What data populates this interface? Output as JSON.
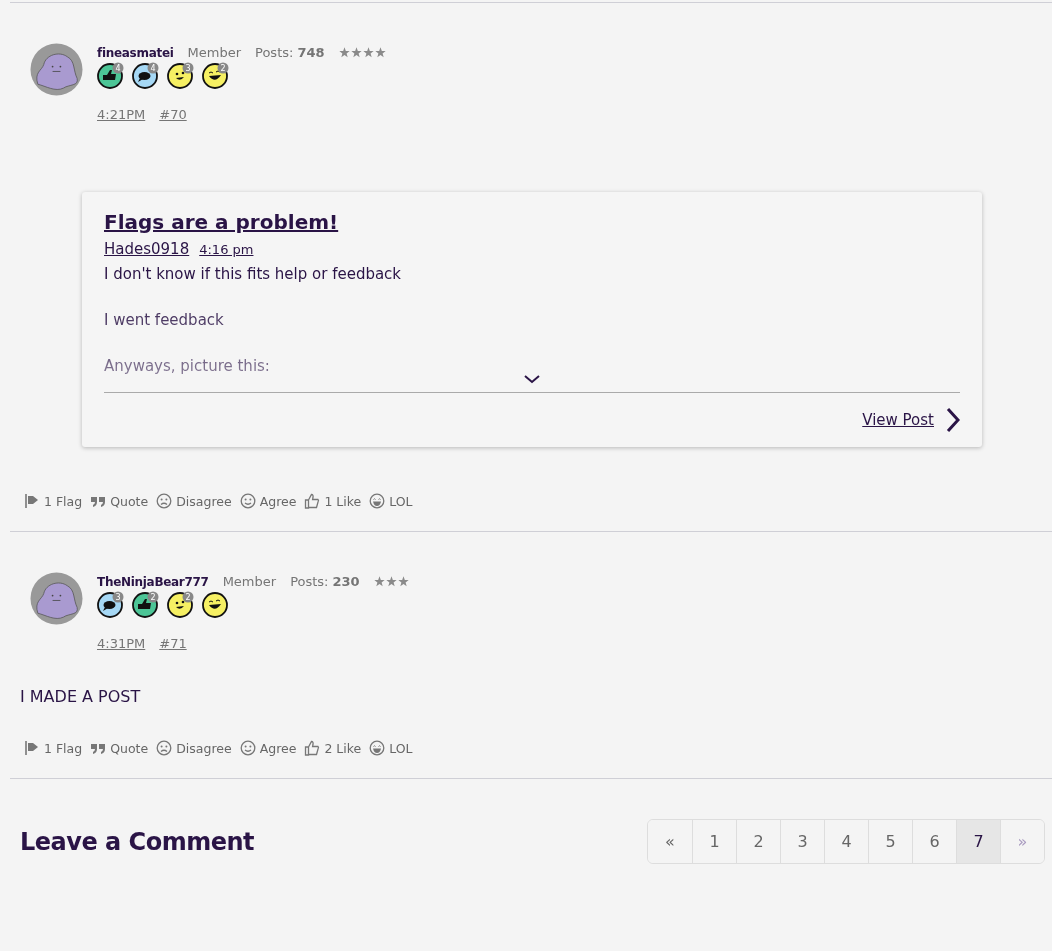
{
  "posts": [
    {
      "author": "fineasmatei",
      "role": "Member",
      "posts_label": "Posts:",
      "posts_count": "748",
      "stars": 4,
      "badges": [
        {
          "kind": "like",
          "count": "4"
        },
        {
          "kind": "comment",
          "count": "4"
        },
        {
          "kind": "wink",
          "count": "3"
        },
        {
          "kind": "grin",
          "count": "2"
        }
      ],
      "time": "4:21PM",
      "number": "#70",
      "quote": {
        "title": "Flags are a problem!",
        "author": "Hades0918",
        "time": "4:16 pm",
        "collapsed": true,
        "paragraphs": [
          "I don't know if this fits help or feedback",
          "I went feedback",
          "Anyways, picture this:"
        ],
        "link": "View Post"
      },
      "actions": [
        {
          "kind": "flag",
          "label": "1 Flag"
        },
        {
          "kind": "quote",
          "label": "Quote"
        },
        {
          "kind": "disagree",
          "label": "Disagree"
        },
        {
          "kind": "agree",
          "label": "Agree"
        },
        {
          "kind": "like",
          "label": "1 Like"
        },
        {
          "kind": "lol",
          "label": "LOL"
        }
      ]
    },
    {
      "author": "TheNinjaBear777",
      "role": "Member",
      "posts_label": "Posts:",
      "posts_count": "230",
      "stars": 3,
      "badges": [
        {
          "kind": "comment",
          "count": "3"
        },
        {
          "kind": "like",
          "count": "2"
        },
        {
          "kind": "wink",
          "count": "2"
        },
        {
          "kind": "grin"
        }
      ],
      "time": "4:31PM",
      "number": "#71",
      "body": "I MADE A POST",
      "actions": [
        {
          "kind": "flag",
          "label": "1 Flag"
        },
        {
          "kind": "quote",
          "label": "Quote"
        },
        {
          "kind": "disagree",
          "label": "Disagree"
        },
        {
          "kind": "agree",
          "label": "Agree"
        },
        {
          "kind": "like",
          "label": "2 Like"
        },
        {
          "kind": "lol",
          "label": "LOL"
        }
      ]
    }
  ],
  "comment_heading": "Leave a Comment",
  "pagination": [
    {
      "label": "«",
      "selected": false,
      "disabled": false
    },
    {
      "label": "1",
      "selected": false,
      "disabled": false
    },
    {
      "label": "2",
      "selected": false,
      "disabled": false
    },
    {
      "label": "3",
      "selected": false,
      "disabled": false
    },
    {
      "label": "4",
      "selected": false,
      "disabled": false
    },
    {
      "label": "5",
      "selected": false,
      "disabled": false
    },
    {
      "label": "6",
      "selected": false,
      "disabled": false
    },
    {
      "label": "7",
      "selected": true,
      "disabled": false
    },
    {
      "label": "»",
      "selected": false,
      "disabled": true
    }
  ]
}
